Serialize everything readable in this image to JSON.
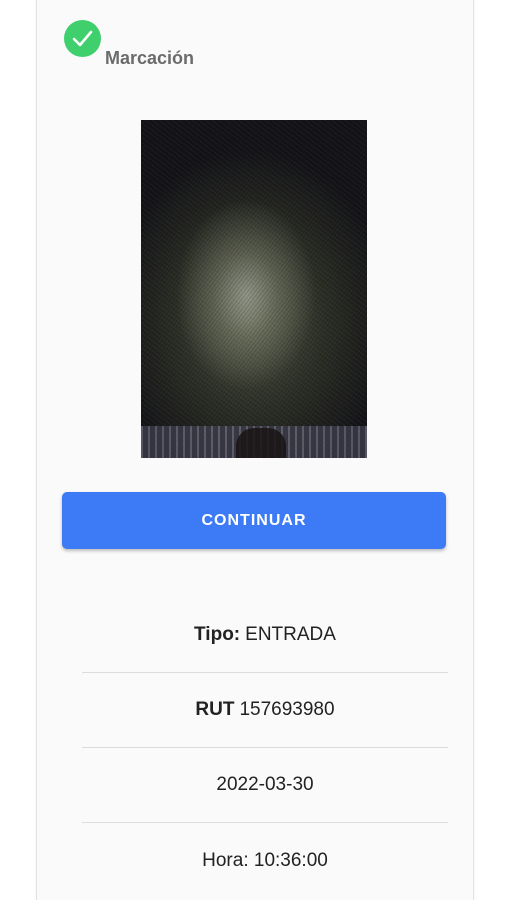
{
  "header": {
    "title": "Marcación",
    "status_icon": "check-circle-icon",
    "status_color": "#3fcf6c"
  },
  "photo": {
    "description_icon": "captured-photo"
  },
  "actions": {
    "continue_label": "CONTINUAR",
    "button_color": "#3d7bf6"
  },
  "details": {
    "tipo_label": "Tipo:",
    "tipo_value": "ENTRADA",
    "rut_label": "RUT",
    "rut_value": "157693980",
    "date": "2022-03-30",
    "hora": "Hora: 10:36:00"
  }
}
